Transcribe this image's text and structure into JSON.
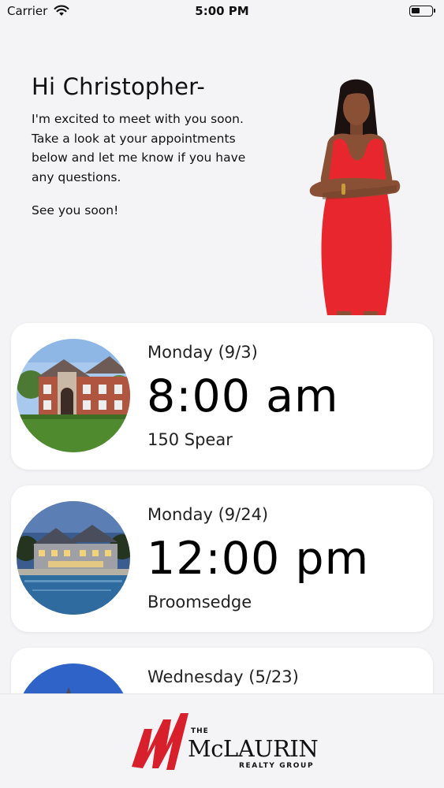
{
  "status_bar": {
    "carrier": "Carrier",
    "time": "5:00 PM",
    "battery_level": 0.45
  },
  "greeting": {
    "title": "Hi Christopher-",
    "body": "I'm excited to meet with you soon. Take a look at your appointments below and let me know if you have any questions.",
    "signoff": "See you soon!"
  },
  "appointments": [
    {
      "day": "Monday (9/3)",
      "time": "8:00 am",
      "place": "150 Spear"
    },
    {
      "day": "Monday (9/24)",
      "time": "12:00 pm",
      "place": "Broomsedge"
    },
    {
      "day": "Wednesday (5/23)",
      "time": "",
      "place": ""
    }
  ],
  "footer": {
    "logo_the": "THE",
    "logo_name": "McLAURIN",
    "logo_sub": "REALTY GROUP",
    "brand_color": "#d8202c"
  },
  "colors": {
    "background": "#f4f4f6",
    "card": "#ffffff",
    "dress": "#e8262e"
  }
}
